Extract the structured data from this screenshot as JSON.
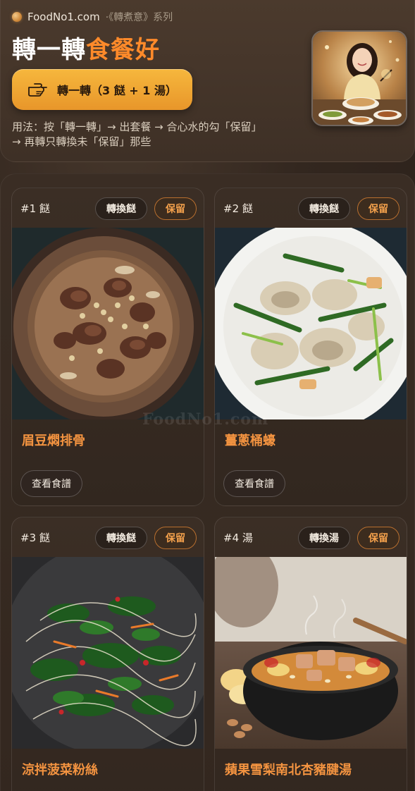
{
  "header": {
    "site": "FoodNo1.com",
    "series": "·《轉煮意》系列",
    "title_part1": "轉一轉",
    "title_part2": "食餐好",
    "spin_button_label": "轉一轉（3 餸 + 1 湯）",
    "usage_line1": "用法：按「轉一轉」→ 出套餐 → 合心水的勾「保留」",
    "usage_line2": "→ 再轉只轉換未「保留」那些",
    "avatar_icon": "chef-woman-dining-icon"
  },
  "cards": [
    {
      "index": "#1 餸",
      "swap_label": "轉換餸",
      "keep_label": "保留",
      "dish_name": "眉豆燜排骨",
      "recipe_label": "查看食譜",
      "photo_icon": "braised-ribs-photo"
    },
    {
      "index": "#2 餸",
      "swap_label": "轉換餸",
      "keep_label": "保留",
      "dish_name": "薑蔥桶蠔",
      "recipe_label": "查看食譜",
      "photo_icon": "ginger-scallion-oysters-photo"
    },
    {
      "index": "#3 餸",
      "swap_label": "轉換餸",
      "keep_label": "保留",
      "dish_name": "涼拌菠菜粉絲",
      "recipe_label": "",
      "photo_icon": "spinach-vermicelli-photo"
    },
    {
      "index": "#4 湯",
      "swap_label": "轉換湯",
      "keep_label": "保留",
      "dish_name": "蘋果雪梨南北杏豬腱湯",
      "recipe_label": "",
      "photo_icon": "apple-pear-pork-soup-photo"
    }
  ],
  "watermark": "FoodNo1.com",
  "colors": {
    "accent_orange": "#ff8a2a",
    "button_gold": "#f6b73d",
    "dish_name": "#f39340",
    "keep_border": "#b86f2f",
    "background": "#33271f"
  }
}
